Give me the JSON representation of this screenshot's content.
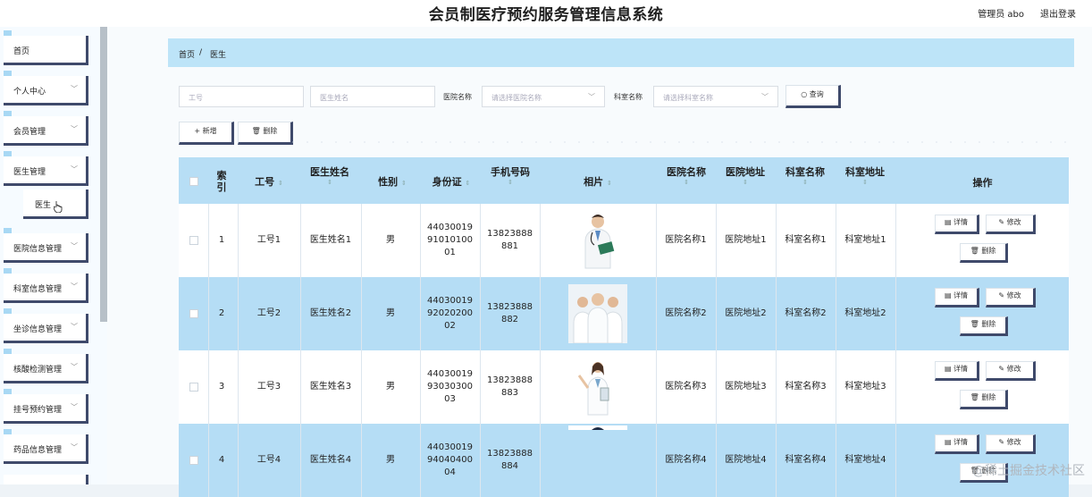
{
  "header": {
    "title": "会员制医疗预约服务管理信息系统",
    "admin": "管理员 abo",
    "logout": "退出登录"
  },
  "sidebar": {
    "items": [
      {
        "label": "首页",
        "chevron": ""
      },
      {
        "label": "个人中心",
        "chevron": "﹀"
      },
      {
        "label": "会员管理",
        "chevron": "﹀"
      },
      {
        "label": "医生管理",
        "chevron": "﹀"
      },
      {
        "label": "医生",
        "chevron": ""
      },
      {
        "label": "医院信息管理",
        "chevron": "﹀"
      },
      {
        "label": "科室信息管理",
        "chevron": "﹀"
      },
      {
        "label": "坐诊信息管理",
        "chevron": "﹀"
      },
      {
        "label": "核酸检测管理",
        "chevron": "﹀"
      },
      {
        "label": "挂号预约管理",
        "chevron": "﹀"
      },
      {
        "label": "药品信息管理",
        "chevron": "﹀"
      }
    ]
  },
  "breadcrumb": {
    "home": "首页",
    "sep": "/",
    "current": "医生"
  },
  "filters": {
    "gonghao_placeholder": "工号",
    "name_placeholder": "医生姓名",
    "hospital_label": "医院名称",
    "hospital_placeholder": "请选择医院名称",
    "dept_label": "科室名称",
    "dept_placeholder": "请选择科室名称",
    "search_label": "○ 查询",
    "chevron": "﹀"
  },
  "actions": {
    "add": "+ 新增",
    "delete": "🗑 删除"
  },
  "table": {
    "headers": {
      "index": "索引",
      "gonghao": "工号",
      "name": "医生姓名",
      "gender": "性别",
      "idcard": "身份证",
      "phone": "手机号码",
      "photo": "相片",
      "hospital": "医院名称",
      "address": "医院地址",
      "dept": "科室名称",
      "deptaddr": "科室地址",
      "ops": "操作"
    },
    "sort_icon": "⇕",
    "ops": {
      "detail": "▤ 详情",
      "edit": "✎ 修改",
      "delete": "🗑 删除"
    },
    "rows": [
      {
        "index": "1",
        "gonghao": "工号1",
        "name": "医生姓名1",
        "gender": "男",
        "idcard": [
          "44030019",
          "91010100",
          "01"
        ],
        "phone": [
          "13823888",
          "881"
        ],
        "hospital": "医院名称1",
        "address": "医院地址1",
        "dept": "科室名称1",
        "deptaddr": "科室地址1"
      },
      {
        "index": "2",
        "gonghao": "工号2",
        "name": "医生姓名2",
        "gender": "男",
        "idcard": [
          "44030019",
          "92020200",
          "02"
        ],
        "phone": [
          "13823888",
          "882"
        ],
        "hospital": "医院名称2",
        "address": "医院地址2",
        "dept": "科室名称2",
        "deptaddr": "科室地址2"
      },
      {
        "index": "3",
        "gonghao": "工号3",
        "name": "医生姓名3",
        "gender": "男",
        "idcard": [
          "44030019",
          "93030300",
          "03"
        ],
        "phone": [
          "13823888",
          "883"
        ],
        "hospital": "医院名称3",
        "address": "医院地址3",
        "dept": "科室名称3",
        "deptaddr": "科室地址3"
      },
      {
        "index": "4",
        "gonghao": "工号4",
        "name": "医生姓名4",
        "gender": "男",
        "idcard": [
          "44030019",
          "94040400",
          "04"
        ],
        "phone": [
          "13823888",
          "884"
        ],
        "hospital": "医院名称4",
        "address": "医院地址4",
        "dept": "科室名称4",
        "deptaddr": "科室地址4"
      }
    ]
  },
  "watermark": "@稀土掘金技术社区"
}
